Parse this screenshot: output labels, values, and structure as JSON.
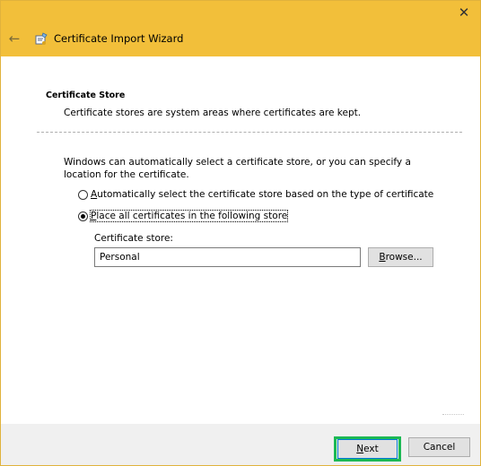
{
  "window": {
    "title": "Certificate Import Wizard",
    "close_glyph": "✕",
    "back_glyph": "←"
  },
  "section": {
    "title": "Certificate Store",
    "description": "Certificate stores are system areas where certificates are kept."
  },
  "intro": "Windows can automatically select a certificate store, or you can specify a location for the certificate.",
  "options": {
    "auto": {
      "label_first": "A",
      "label_rest": "utomatically select the certificate store based on the type of certificate",
      "checked": false
    },
    "manual": {
      "label_first": "P",
      "label_rest": "lace all certificates in the following store",
      "checked": true
    }
  },
  "store": {
    "label": "Certificate store:",
    "value": "Personal",
    "browse_first": "B",
    "browse_rest": "rowse..."
  },
  "footer": {
    "next_first": "N",
    "next_rest": "ext",
    "cancel_label": "Cancel"
  },
  "colors": {
    "titlebar": "#f2bf3a",
    "highlight": "#1db954",
    "focus": "#0078d7"
  },
  "icons": {
    "wizard": "certificate-wizard-icon",
    "back": "back-arrow-icon",
    "close": "close-icon"
  }
}
